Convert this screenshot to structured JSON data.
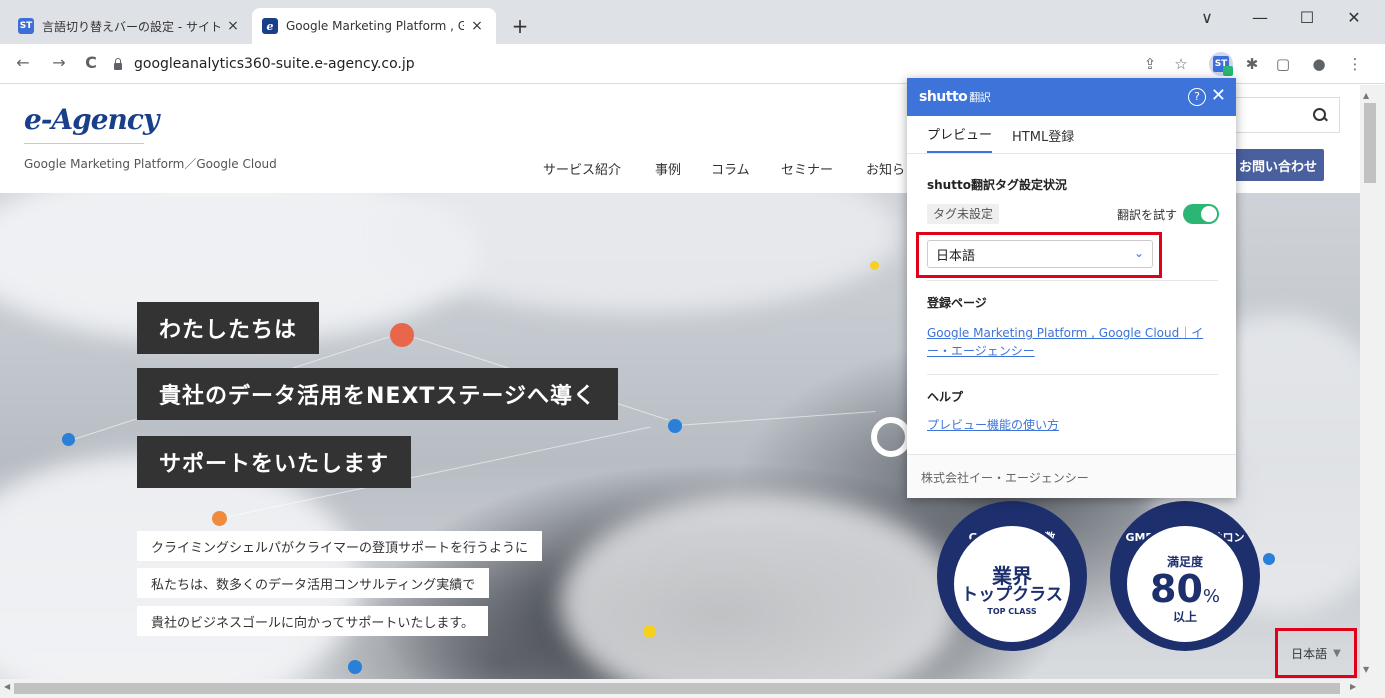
{
  "browser": {
    "tabs": [
      {
        "favicon": "ST",
        "title": "言語切り替えバーの設定 - サイト設定",
        "close": "×"
      },
      {
        "favicon": "e",
        "title": "Google Marketing Platform , Goo",
        "close": "×"
      }
    ],
    "new_tab": "+",
    "window_controls": {
      "dropdown": "∨",
      "minimize": "—",
      "maximize": "☐",
      "close": "✕"
    },
    "nav": {
      "back": "←",
      "forward": "→",
      "reload": "C"
    },
    "url": "googleanalytics360-suite.e-agency.co.jp",
    "toolbar_icons": {
      "share": "⇪",
      "star": "☆",
      "ext_label": "ST",
      "puzzle": "✱",
      "sidepanel": "▢",
      "profile": "●",
      "menu": "⋮"
    }
  },
  "site": {
    "logo": "e-Agency",
    "tagline": "Google Marketing Platform／Google Cloud",
    "nav": [
      "サービス紹介",
      "事例",
      "コラム",
      "セミナー",
      "お知ら"
    ],
    "contact_button": "お問い合わせ",
    "hero": {
      "headlines": [
        "わたしたちは",
        "貴社のデータ活用をNEXTステージへ導く",
        "サポートをいたします"
      ],
      "sublines": [
        "クライミングシェルパがクライマーの登頂サポートを行うように",
        "私たちは、数多くのデータ活用コンサルティング実績で",
        "貴社のビジネスゴールに向かってサポートいたします。"
      ]
    },
    "badges": {
      "left": {
        "top": "GMP のご契約数",
        "big": "業界",
        "mid": "トップクラス",
        "small": "TOP CLASS"
      },
      "right": {
        "top": "GMP プレミアムサロン",
        "label": "満足度",
        "num": "80",
        "pct": "%",
        "bottom": "以上"
      }
    },
    "language_switcher": {
      "value": "日本語",
      "caret": "▼"
    }
  },
  "popup": {
    "brand": "shutto",
    "brand_suffix": "翻訳",
    "help": "?",
    "close": "✕",
    "tabs": [
      "プレビュー",
      "HTML登録"
    ],
    "tag_status_title": "shutto翻訳タグ設定状況",
    "tag_chip": "タグ未設定",
    "try_label": "翻訳を試す",
    "toggle_on": true,
    "language_select": {
      "value": "日本語",
      "chevron": "⌄"
    },
    "registered_page_title": "登録ページ",
    "registered_page_link": "Google Marketing Platform , Google Cloud｜イー・エージェンシー",
    "help_title": "ヘルプ",
    "help_link": "プレビュー機能の使い方",
    "footer": "株式会社イー・エージェンシー"
  },
  "colors": {
    "accent_blue": "#3e73d9",
    "toggle_green": "#2bb673",
    "highlight_red": "#e0001a",
    "contact_button": "#4a5f9e",
    "badge_navy": "#1e2f6e"
  }
}
